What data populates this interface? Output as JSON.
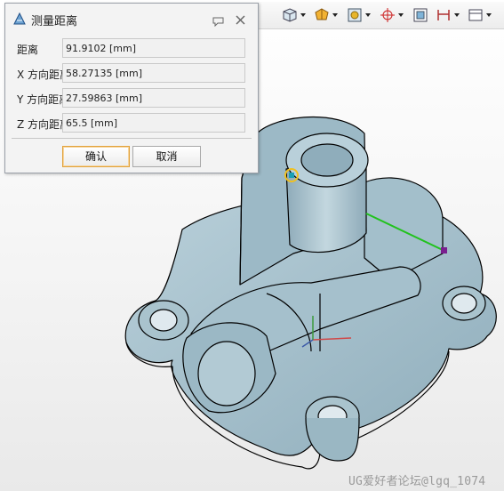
{
  "dialog": {
    "title": "测量距离",
    "rows": [
      {
        "label": "距离",
        "value": "91.9102  [mm]"
      },
      {
        "label": "X 方向距离",
        "value": "58.27135  [mm]"
      },
      {
        "label": "Y 方向距离",
        "value": "27.59863  [mm]"
      },
      {
        "label": "Z 方向距离",
        "value": "65.5  [mm]"
      }
    ],
    "ok_label": "确认",
    "cancel_label": "取消"
  },
  "toolbar": {
    "buttons": [
      "cube-view-icon",
      "shaded-solid-icon",
      "render-style-icon",
      "snap-target-icon",
      "fit-view-icon",
      "dimension-icon",
      "layer-icon"
    ]
  },
  "colors": {
    "model_face": "#a7c1cc",
    "model_dark": "#7b98a6",
    "measure_line": "#21c21d",
    "point_start": "#f0c020",
    "point_end": "#7a1f8f"
  },
  "watermark": "UG爱好者论坛@lgq_1074"
}
